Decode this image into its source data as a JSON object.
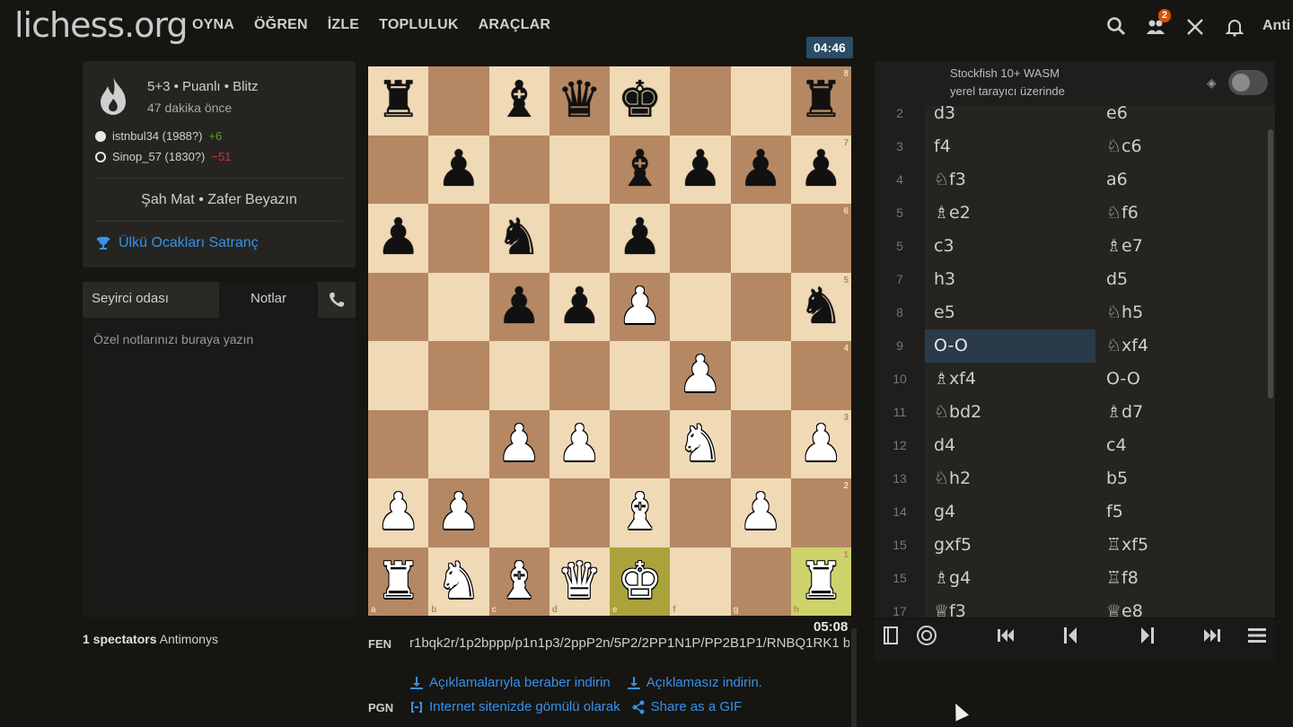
{
  "header": {
    "logo": "lichess.org",
    "nav": [
      "OYNA",
      "ÖĞREN",
      "İZLE",
      "TOPLULUK",
      "ARAÇLAR"
    ],
    "friends_badge": "2",
    "user": "Anti"
  },
  "game": {
    "type": "5+3 • Puanlı • Blitz",
    "time_ago": "47 dakika önce",
    "white_player": "istnbul34 (1988?)",
    "white_diff": "+6",
    "black_player": "Sinop_57 (1830?)",
    "black_diff": "−51",
    "result": "Şah Mat • Zafer Beyazın",
    "tournament": "Ülkü Ocakları Satranç"
  },
  "chat": {
    "tab_spectators": "Seyirci odası",
    "tab_notes": "Notlar",
    "notes_placeholder": "Özel notlarınızı buraya yazın"
  },
  "spectators": {
    "count_label": "1 spectators",
    "names": "Antimonys"
  },
  "clocks": {
    "top": "04:46",
    "bottom": "05:08"
  },
  "board": {
    "ranks": [
      [
        "bR",
        "",
        "bB",
        "bQ",
        "bK",
        "",
        "",
        "bR"
      ],
      [
        "",
        "bP",
        "",
        "",
        "bB",
        "bP",
        "bP",
        "bP"
      ],
      [
        "bP",
        "",
        "bN",
        "",
        "bP",
        "",
        "",
        ""
      ],
      [
        "",
        "",
        "bP",
        "bP",
        "wP",
        "",
        "",
        "bN"
      ],
      [
        "",
        "",
        "",
        "",
        "",
        "wP",
        "",
        ""
      ],
      [
        "",
        "",
        "wP",
        "wP",
        "",
        "wN",
        "",
        "wP"
      ],
      [
        "wP",
        "wP",
        "",
        "",
        "wB",
        "",
        "wP",
        ""
      ],
      [
        "wR",
        "wN",
        "wB",
        "wQ",
        "wK",
        "",
        "",
        "wR"
      ]
    ],
    "highlight": [
      "e1",
      "h1"
    ],
    "files": [
      "a",
      "b",
      "c",
      "d",
      "e",
      "f",
      "g",
      "h"
    ],
    "rank_labels": [
      "8",
      "7",
      "6",
      "5",
      "4",
      "3",
      "2",
      "1"
    ]
  },
  "fen": {
    "label": "FEN",
    "value": "r1bqk2r/1p2bppp/p1n1p3/2ppP2n/5P2/2PP1N1P/PP2B1P1/RNBQ1RK1 b"
  },
  "downloads": {
    "with_annotations": "Açıklamalarıyla beraber indirin",
    "without_annotations": "Açıklamasız indirin."
  },
  "pgn": {
    "label": "PGN",
    "embed": "Internet sitenizde gömülü olarak",
    "gif": "Share as a GIF"
  },
  "engine": {
    "title": "Stockfish 10+ WASM",
    "subtitle": "yerel tarayıcı üzerinde"
  },
  "moves": [
    {
      "n": "2",
      "w": "d3",
      "b": "e6"
    },
    {
      "n": "3",
      "w": "f4",
      "b": "♘c6"
    },
    {
      "n": "4",
      "w": "♘f3",
      "b": "a6"
    },
    {
      "n": "5",
      "w": "♗e2",
      "b": "♘f6"
    },
    {
      "n": "5",
      "w": "c3",
      "b": "♗e7"
    },
    {
      "n": "7",
      "w": "h3",
      "b": "d5"
    },
    {
      "n": "8",
      "w": "e5",
      "b": "♘h5"
    },
    {
      "n": "9",
      "w": "O-O",
      "b": "♘xf4"
    },
    {
      "n": "10",
      "w": "♗xf4",
      "b": "O-O"
    },
    {
      "n": "11",
      "w": "♘bd2",
      "b": "♗d7"
    },
    {
      "n": "12",
      "w": "d4",
      "b": "c4"
    },
    {
      "n": "13",
      "w": "♘h2",
      "b": "b5"
    },
    {
      "n": "14",
      "w": "g4",
      "b": "f5"
    },
    {
      "n": "15",
      "w": "gxf5",
      "b": "♖xf5"
    },
    {
      "n": "15",
      "w": "♗g4",
      "b": "♖f8"
    },
    {
      "n": "17",
      "w": "♕f3",
      "b": "♕e8"
    }
  ],
  "active_move_index": 7,
  "colors": {
    "background": "#161512",
    "panel": "#262421",
    "link": "#3692e7",
    "light_square": "#f0d9b5",
    "dark_square": "#b58863",
    "active_move": "#293a49"
  }
}
